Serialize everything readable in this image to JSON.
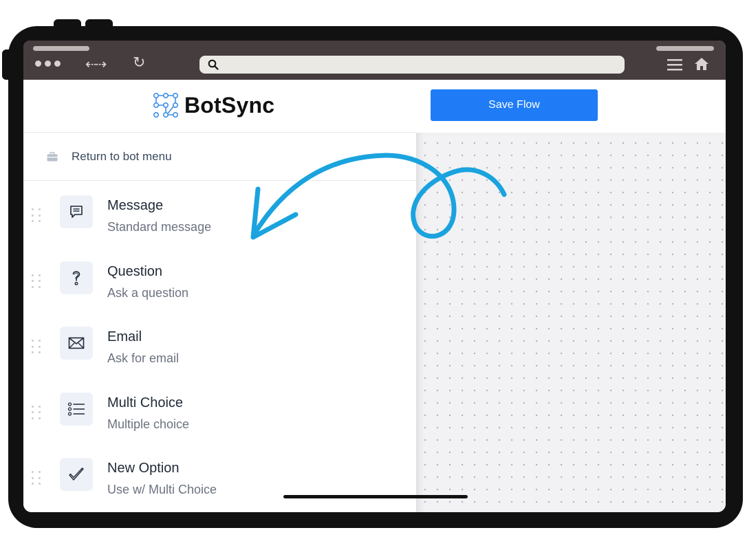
{
  "browser": {
    "url_value": "",
    "icons": {
      "window_dots": "window-controls-icon",
      "back_forward": "back-forward-arrows-icon",
      "reload": "reload-icon",
      "search": "search-icon",
      "menu": "hamburger-menu-icon",
      "home": "home-icon"
    },
    "glyphs": {
      "back_forward": "⇠⇢",
      "reload": "↻"
    }
  },
  "sidebar": {
    "brand": "BotSync",
    "return_label": "Return to bot menu",
    "items": [
      {
        "title": "Message",
        "subtitle": "Standard message",
        "icon": "message-icon"
      },
      {
        "title": "Question",
        "subtitle": "Ask a question",
        "icon": "question-icon"
      },
      {
        "title": "Email",
        "subtitle": "Ask for email",
        "icon": "envelope-icon"
      },
      {
        "title": "Multi Choice",
        "subtitle": "Multiple choice",
        "icon": "list-icon"
      },
      {
        "title": "New Option",
        "subtitle": "Use w/ Multi Choice",
        "icon": "checkmark-icon"
      }
    ]
  },
  "canvas": {
    "save_label": "Save Flow"
  },
  "colors": {
    "accent": "#1f7cf6",
    "annotation_arrow": "#1aa3de",
    "frame": "#111111",
    "browser_bar": "#453d3e"
  }
}
